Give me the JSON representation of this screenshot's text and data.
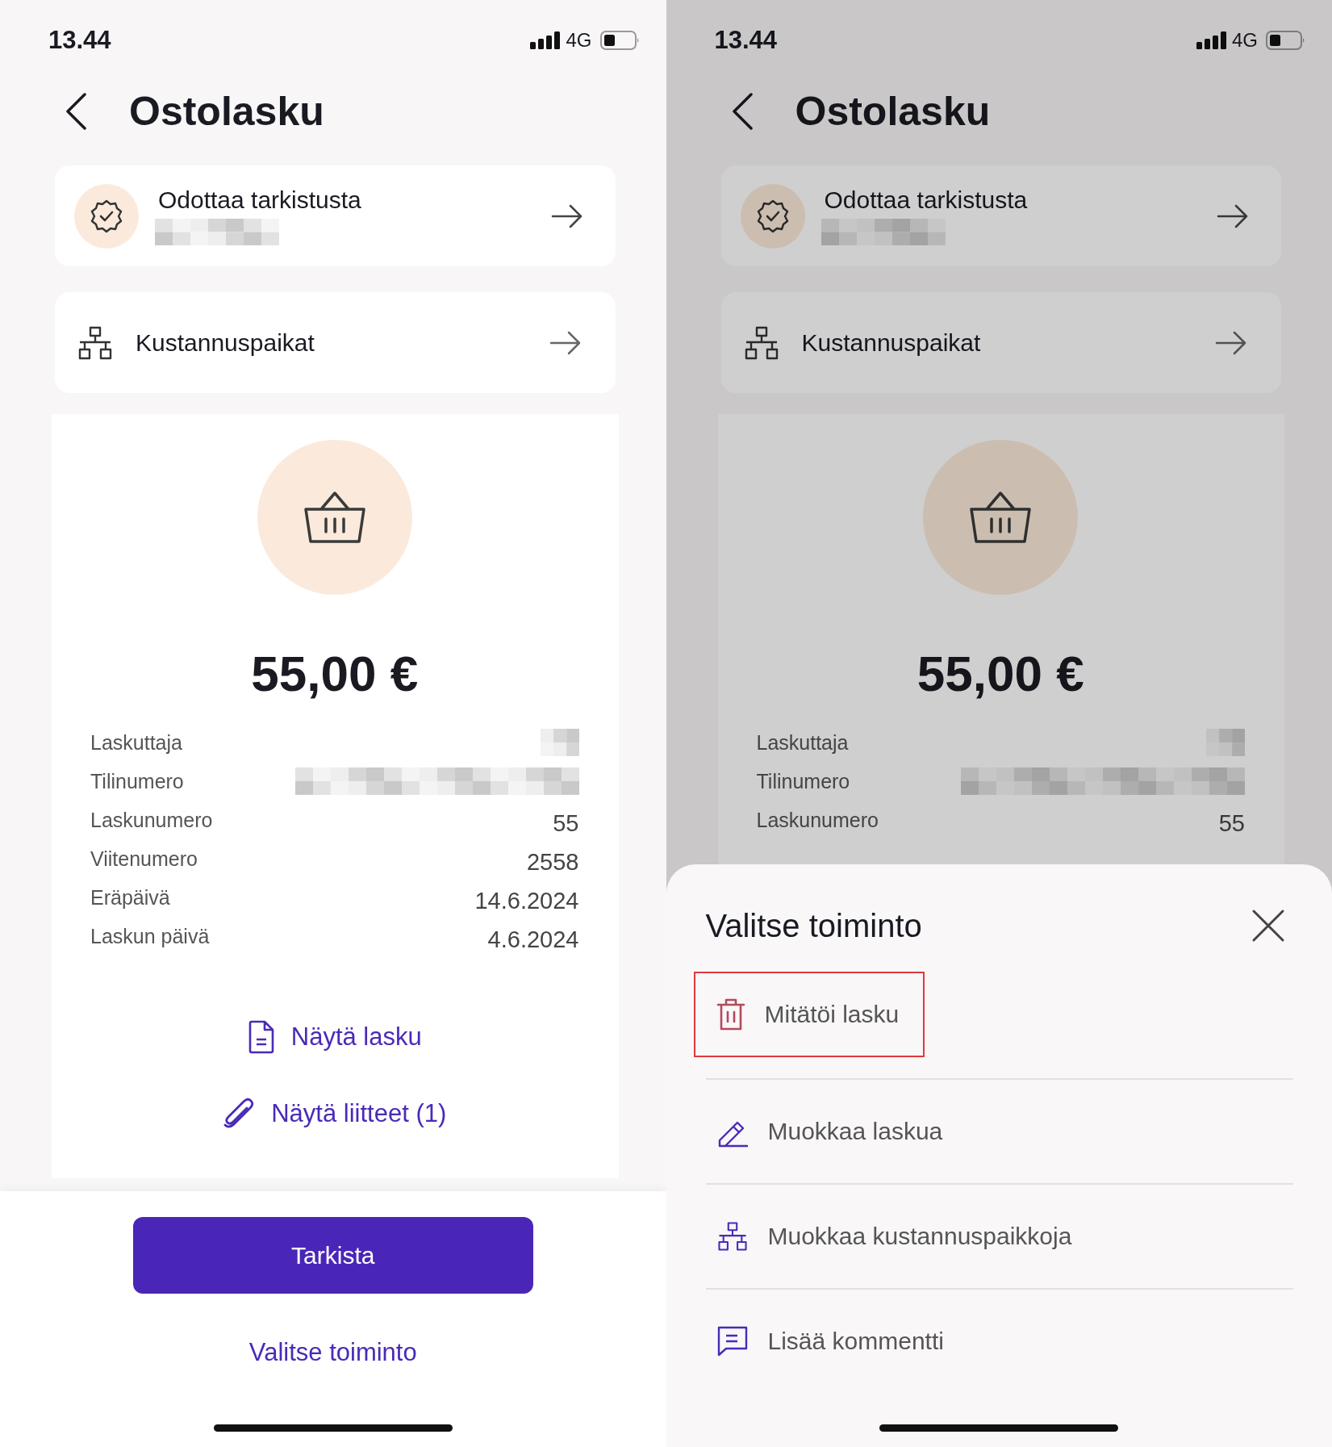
{
  "screens": [
    {
      "dimmed": false,
      "status_bar": {
        "time": "13.44",
        "network": "4G"
      },
      "title": "Ostolasku",
      "status_card": {
        "label": "Odottaa tarkistusta"
      },
      "cost_center_card": {
        "label": "Kustannuspaikat"
      },
      "amount": "55,00 €",
      "details": [
        {
          "label": "Laskuttaja",
          "redacted": true
        },
        {
          "label": "Tilinumero",
          "redacted": true
        },
        {
          "label": "Laskunumero",
          "value": "55",
          "redacted": false
        },
        {
          "label": "Viitenumero",
          "value": "2558",
          "redacted": false
        },
        {
          "label": "Eräpäivä",
          "value": "14.6.2024",
          "redacted": false
        },
        {
          "label": "Laskun päivä",
          "value": "4.6.2024",
          "redacted": false
        }
      ],
      "links": [
        {
          "kind": "document",
          "label": "Näytä lasku"
        },
        {
          "kind": "attachment",
          "label": "Näytä liitteet (1)"
        }
      ],
      "primary_button": "Tarkista",
      "secondary_link": "Valitse toiminto"
    },
    {
      "dimmed": true,
      "status_bar": {
        "time": "13.44",
        "network": "4G"
      },
      "title": "Ostolasku",
      "status_card": {
        "label": "Odottaa tarkistusta"
      },
      "cost_center_card": {
        "label": "Kustannuspaikat"
      },
      "amount": "55,00 €",
      "details": [
        {
          "label": "Laskuttaja",
          "redacted": true
        },
        {
          "label": "Tilinumero",
          "redacted": true
        },
        {
          "label": "Laskunumero",
          "value": "55",
          "redacted": false
        }
      ],
      "action_sheet": {
        "title": "Valitse toiminto",
        "items": [
          {
            "kind": "trash",
            "label": "Mitätöi lasku",
            "highlighted": true
          },
          {
            "kind": "pencil",
            "label": "Muokkaa laskua",
            "highlighted": false
          },
          {
            "kind": "network",
            "label": "Muokkaa kustannuspaikkoja",
            "highlighted": false
          },
          {
            "kind": "comment",
            "label": "Lisää kommentti",
            "highlighted": false
          }
        ]
      }
    }
  ]
}
